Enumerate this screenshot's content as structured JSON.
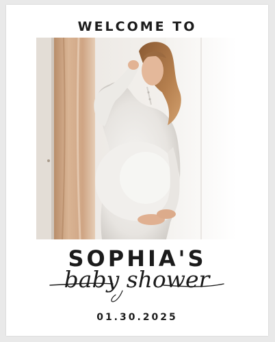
{
  "sign": {
    "heading": "WELCOME TO",
    "name": "SOPHIA'S",
    "event_script": "baby shower",
    "date": "01.30.2025",
    "photo_subject": "pregnant-woman-photo"
  },
  "colors": {
    "ink": "#1b1b1b",
    "paper": "#ffffff",
    "backdrop": "#e9e9e9"
  }
}
